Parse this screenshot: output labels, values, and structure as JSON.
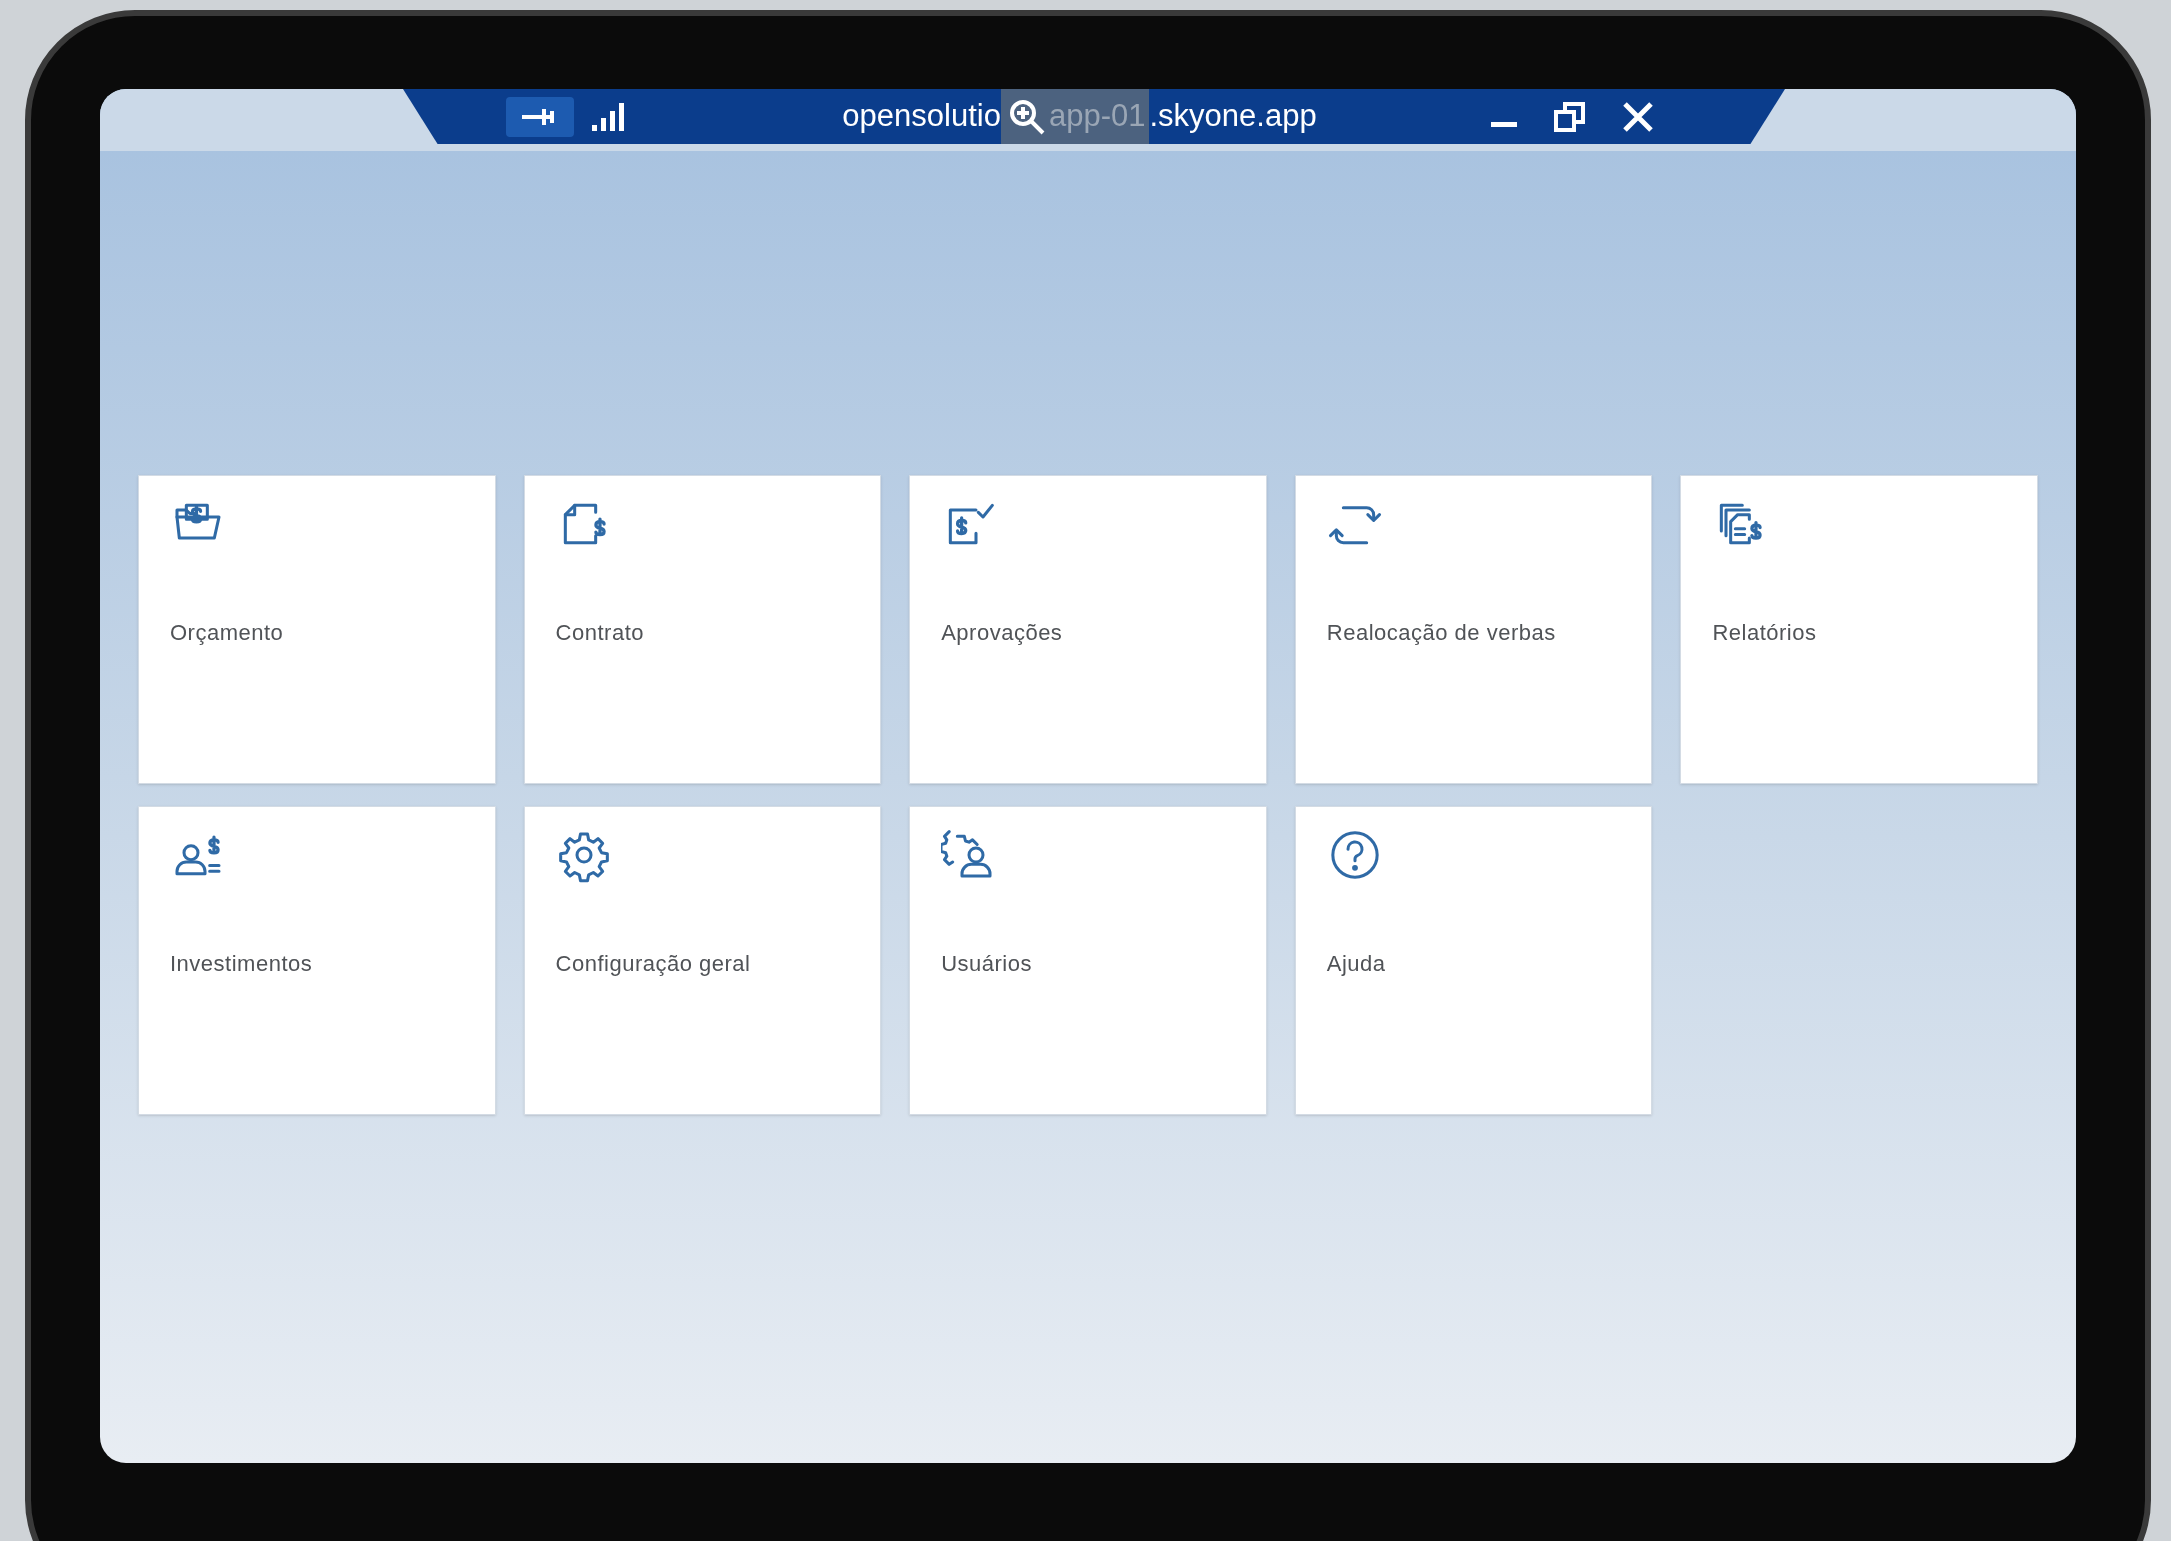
{
  "remote_bar": {
    "title_start": "opensolutio",
    "title_covered": "app-01",
    "title_end": ".skyone.app",
    "pinned": true
  },
  "tiles": [
    {
      "label": "Orçamento"
    },
    {
      "label": "Contrato"
    },
    {
      "label": "Aprovações"
    },
    {
      "label": "Realocação de verbas"
    },
    {
      "label": "Relatórios"
    },
    {
      "label": "Investimentos"
    },
    {
      "label": "Configuração geral"
    },
    {
      "label": "Usuários"
    },
    {
      "label": "Ajuda"
    }
  ]
}
